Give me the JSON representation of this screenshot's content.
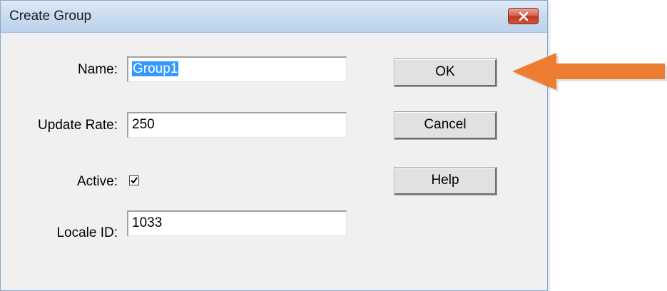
{
  "window": {
    "title": "Create Group"
  },
  "form": {
    "name_label": "Name:",
    "name_value": "Group1",
    "update_rate_label": "Update Rate:",
    "update_rate_value": "250",
    "active_label": "Active:",
    "active_checked": true,
    "locale_label": "Locale ID:",
    "locale_value": "1033"
  },
  "buttons": {
    "ok": "OK",
    "cancel": "Cancel",
    "help": "Help"
  },
  "icons": {
    "close": "close-icon",
    "checkmark": "checkmark-icon",
    "annotation": "arrow-icon"
  },
  "colors": {
    "selection": "#3399ff",
    "close_button": "#c9442e",
    "annotation_arrow": "#ed7d31"
  }
}
